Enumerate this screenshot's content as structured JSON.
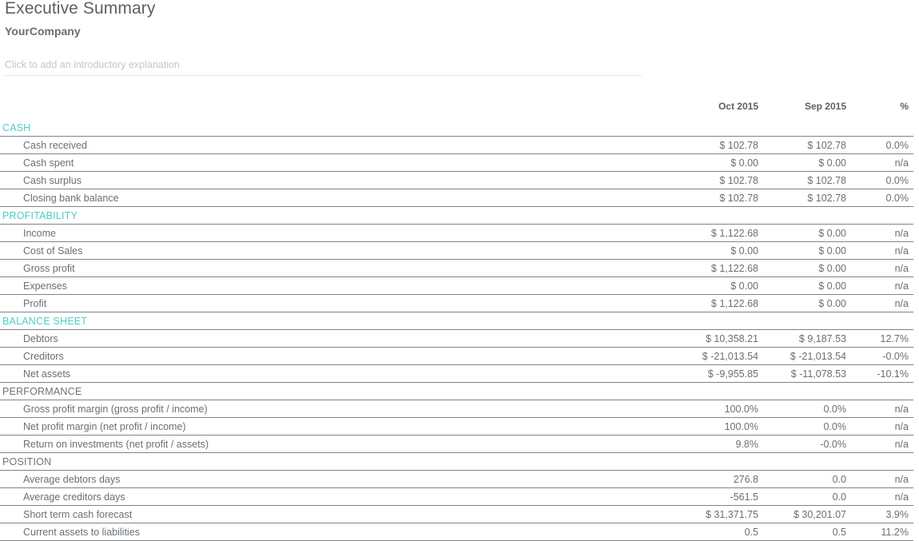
{
  "header": {
    "title": "Executive Summary",
    "company": "YourCompany",
    "intro_placeholder": "Click to add an introductory explanation"
  },
  "colors": {
    "section_accent": "#4ecdc4",
    "positive": "#2ab34a",
    "negative": "#f4422e",
    "text": "#6a6f74"
  },
  "table": {
    "columns": [
      "",
      "Oct 2015",
      "Sep 2015",
      "%"
    ],
    "sections": [
      {
        "name": "CASH",
        "style": "teal",
        "rows": [
          {
            "label": "Cash received",
            "current": "$ 102.78",
            "previous": "$ 102.78",
            "pct": "0.0%",
            "pct_sign": "neg"
          },
          {
            "label": "Cash spent",
            "current": "$ 0.00",
            "previous": "$ 0.00",
            "pct": "n/a",
            "pct_sign": "na"
          },
          {
            "label": "Cash surplus",
            "current": "$ 102.78",
            "previous": "$ 102.78",
            "pct": "0.0%",
            "pct_sign": "neg"
          },
          {
            "label": "Closing bank balance",
            "current": "$ 102.78",
            "previous": "$ 102.78",
            "pct": "0.0%",
            "pct_sign": "neg"
          }
        ]
      },
      {
        "name": "PROFITABILITY",
        "style": "teal",
        "rows": [
          {
            "label": "Income",
            "current": "$ 1,122.68",
            "previous": "$ 0.00",
            "pct": "n/a",
            "pct_sign": "na"
          },
          {
            "label": "Cost of Sales",
            "current": "$ 0.00",
            "previous": "$ 0.00",
            "pct": "n/a",
            "pct_sign": "na"
          },
          {
            "label": "Gross profit",
            "current": "$ 1,122.68",
            "previous": "$ 0.00",
            "pct": "n/a",
            "pct_sign": "na"
          },
          {
            "label": "Expenses",
            "current": "$ 0.00",
            "previous": "$ 0.00",
            "pct": "n/a",
            "pct_sign": "na"
          },
          {
            "label": "Profit",
            "current": "$ 1,122.68",
            "previous": "$ 0.00",
            "pct": "n/a",
            "pct_sign": "na"
          }
        ]
      },
      {
        "name": "BALANCE SHEET",
        "style": "teal",
        "rows": [
          {
            "label": "Debtors",
            "current": "$ 10,358.21",
            "previous": "$ 9,187.53",
            "pct": "12.7%",
            "pct_sign": "pos"
          },
          {
            "label": "Creditors",
            "current": "$ -21,013.54",
            "previous": "$ -21,013.54",
            "pct": "-0.0%",
            "pct_sign": "pos"
          },
          {
            "label": "Net assets",
            "current": "$ -9,955.85",
            "previous": "$ -11,078.53",
            "pct": "-10.1%",
            "pct_sign": "neg"
          }
        ]
      },
      {
        "name": "PERFORMANCE",
        "style": "gray",
        "rows": [
          {
            "label": "Gross profit margin (gross profit / income)",
            "current": "100.0%",
            "previous": "0.0%",
            "pct": "n/a",
            "pct_sign": "na"
          },
          {
            "label": "Net profit margin (net profit / income)",
            "current": "100.0%",
            "previous": "0.0%",
            "pct": "n/a",
            "pct_sign": "na"
          },
          {
            "label": "Return on investments (net profit / assets)",
            "current": "9.8%",
            "previous": "-0.0%",
            "pct": "n/a",
            "pct_sign": "na"
          }
        ]
      },
      {
        "name": "POSITION",
        "style": "gray",
        "rows": [
          {
            "label": "Average debtors days",
            "current": "276.8",
            "previous": "0.0",
            "pct": "n/a",
            "pct_sign": "na"
          },
          {
            "label": "Average creditors days",
            "current": "-561.5",
            "previous": "0.0",
            "pct": "n/a",
            "pct_sign": "na"
          },
          {
            "label": "Short term cash forecast",
            "current": "$ 31,371.75",
            "previous": "$ 30,201.07",
            "pct": "3.9%",
            "pct_sign": "pos"
          },
          {
            "label": "Current assets to liabilities",
            "current": "0.5",
            "previous": "0.5",
            "pct": "11.2%",
            "pct_sign": "pos"
          }
        ]
      }
    ]
  }
}
